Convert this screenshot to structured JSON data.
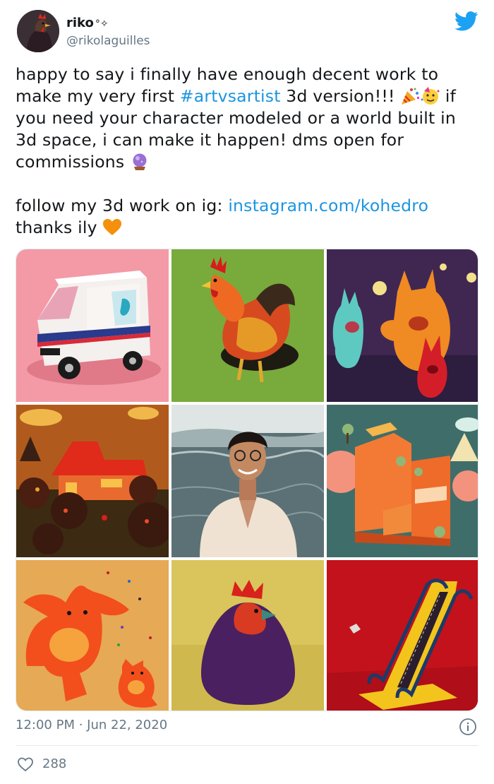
{
  "user": {
    "display_name": "riko",
    "name_decoration": "°✧",
    "handle": "@rikolaguilles"
  },
  "tweet": {
    "line1": "happy to say i finally have enough decent work to",
    "line2_prefix": "make my very first ",
    "hashtag": "#artvsartist",
    "line2_suffix": " 3d version!!! ",
    "line2_end": " if",
    "line3": "you need your character modeled or a world built in",
    "line4": "3d space, i can make it happen! dms open for",
    "line5": "commissions ",
    "line6_prefix": "follow my 3d work on ig: ",
    "link": "instagram.com/kohedro",
    "line7": " thanks ily "
  },
  "media": {
    "tiles": [
      {
        "name": "delivery-van",
        "bg": "#f08ea0"
      },
      {
        "name": "rooster",
        "bg": "#76a83a"
      },
      {
        "name": "monsters",
        "bg": "#3e2650"
      },
      {
        "name": "village-night",
        "bg": "#b05a1c"
      },
      {
        "name": "portrait-sea",
        "bg": "#5e7378"
      },
      {
        "name": "orange-buildings",
        "bg": "#3f6f6a"
      },
      {
        "name": "bears",
        "bg": "#e2a552"
      },
      {
        "name": "chicken-blob",
        "bg": "#d9c35a"
      },
      {
        "name": "escalator",
        "bg": "#c0121a"
      }
    ]
  },
  "footer": {
    "time": "12:00 PM",
    "separator": " · ",
    "date": "Jun 22, 2020",
    "likes": "288"
  },
  "colors": {
    "link": "#1b95e0",
    "twitter_blue": "#1da1f2",
    "muted": "#657786"
  }
}
